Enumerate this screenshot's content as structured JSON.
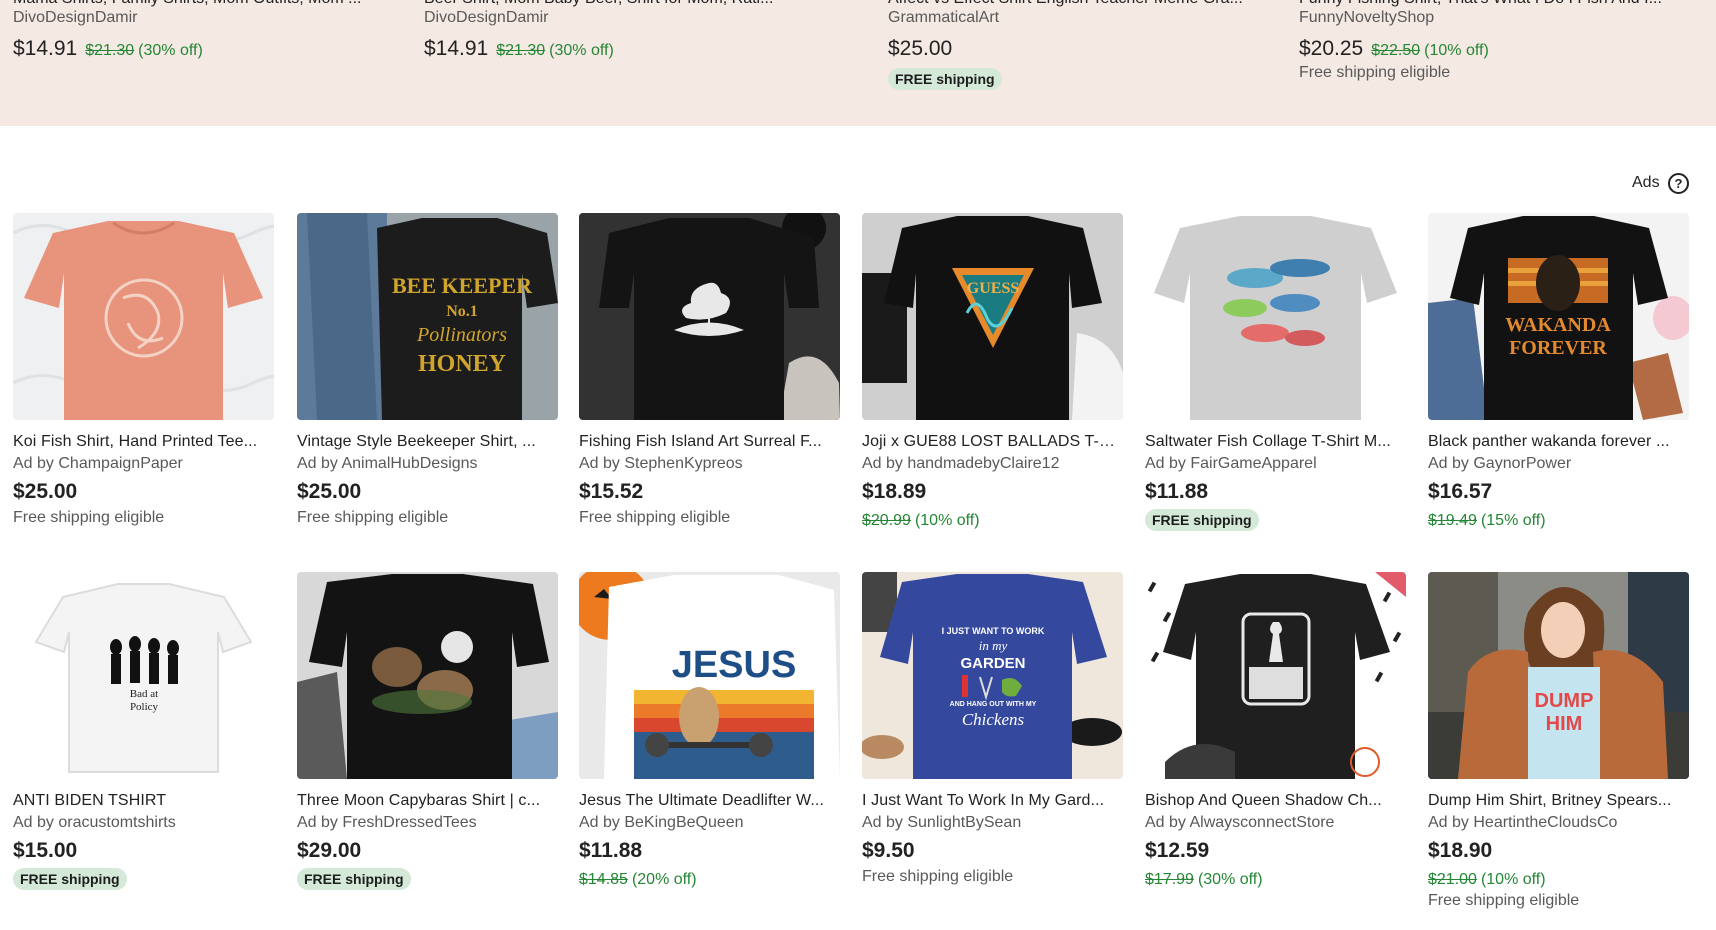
{
  "top_row": [
    {
      "title": "Mama Shirts, Family Shirts, Mom Outfits, Mom ...",
      "shop": "DivoDesignDamir",
      "price": "$14.91",
      "original": "$21.30",
      "discount": "(30% off)",
      "shipping": ""
    },
    {
      "title": "Beer Shirt, Mom Baby Beer, Shirt for Mom, Rati...",
      "shop": "DivoDesignDamir",
      "price": "$14.91",
      "original": "$21.30",
      "discount": "(30% off)",
      "shipping": ""
    },
    {
      "title": "Affect vs Effect Shirt English Teacher Meme Gra...",
      "shop": "GrammaticalArt",
      "price": "$25.00",
      "original": "",
      "discount": "",
      "shipping": "FREE shipping"
    },
    {
      "title": "Funny Fishing Shirt, That's What I Do I Fish And I...",
      "shop": "FunnyNoveltyShop",
      "price": "$20.25",
      "original": "$22.50",
      "discount": "(10% off)",
      "shipping": "Free shipping eligible"
    }
  ],
  "ads_label": "Ads",
  "ads_help": "?",
  "row1": [
    {
      "title": "Koi Fish Shirt, Hand Printed Tee...",
      "shop": "Ad by ChampaignPaper",
      "price": "$25.00",
      "original": "",
      "discount": "",
      "eligible": "Free shipping eligible",
      "badge": ""
    },
    {
      "title": "Vintage Style Beekeeper Shirt, ...",
      "shop": "Ad by AnimalHubDesigns",
      "price": "$25.00",
      "original": "",
      "discount": "",
      "eligible": "Free shipping eligible",
      "badge": ""
    },
    {
      "title": "Fishing Fish Island Art Surreal F...",
      "shop": "Ad by StephenKypreos",
      "price": "$15.52",
      "original": "",
      "discount": "",
      "eligible": "Free shipping eligible",
      "badge": ""
    },
    {
      "title": "Joji x GUE88 LOST BALLADS T-S...",
      "shop": "Ad by handmadebyClaire12",
      "price": "$18.89",
      "original": "$20.99",
      "discount": "(10% off)",
      "eligible": "",
      "badge": ""
    },
    {
      "title": "Saltwater Fish Collage T-Shirt M...",
      "shop": "Ad by FairGameApparel",
      "price": "$11.88",
      "original": "",
      "discount": "",
      "eligible": "",
      "badge": "FREE shipping"
    },
    {
      "title": "Black panther wakanda forever ...",
      "shop": "Ad by GaynorPower",
      "price": "$16.57",
      "original": "$19.49",
      "discount": "(15% off)",
      "eligible": "",
      "badge": ""
    }
  ],
  "row2": [
    {
      "title": "ANTI BIDEN TSHIRT",
      "shop": "Ad by oracustomtshirts",
      "price": "$15.00",
      "original": "",
      "discount": "",
      "eligible": "",
      "badge": "FREE shipping"
    },
    {
      "title": "Three Moon Capybaras Shirt | c...",
      "shop": "Ad by FreshDressedTees",
      "price": "$29.00",
      "original": "",
      "discount": "",
      "eligible": "",
      "badge": "FREE shipping"
    },
    {
      "title": "Jesus The Ultimate Deadlifter W...",
      "shop": "Ad by BeKingBeQueen",
      "price": "$11.88",
      "original": "$14.85",
      "discount": "(20% off)",
      "eligible": "",
      "badge": ""
    },
    {
      "title": "I Just Want To Work In My Gard...",
      "shop": "Ad by SunlightBySean",
      "price": "$9.50",
      "original": "",
      "discount": "",
      "eligible": "Free shipping eligible",
      "badge": ""
    },
    {
      "title": "Bishop And Queen Shadow Ch...",
      "shop": "Ad by AlwaysconnectStore",
      "price": "$12.59",
      "original": "$17.99",
      "discount": "(30% off)",
      "eligible": "",
      "badge": ""
    },
    {
      "title": "Dump Him Shirt, Britney Spears...",
      "shop": "Ad by HeartintheCloudsCo",
      "price": "$18.90",
      "original": "$21.00",
      "discount": "(10% off)",
      "eligible": "Free shipping eligible",
      "badge": ""
    }
  ],
  "shirt_prints": {
    "bee": [
      "BEE KEEPER",
      "No.1",
      "Pollinators",
      "HONEY"
    ],
    "guess": "GUESS",
    "wakanda": [
      "WAKANDA",
      "FOREVER"
    ],
    "biden": [
      "Bad at",
      "Policy"
    ],
    "jesus": "JESUS",
    "garden": [
      "I JUST WANT TO WORK",
      "in my",
      "GARDEN",
      "AND HANG OUT WITH MY",
      "Chickens"
    ],
    "dump": [
      "DUMP",
      "HIM"
    ]
  },
  "colors": {
    "discount_green": "#258635",
    "badge_bg": "#d4e9d7",
    "top_band": "#f5e9e4"
  }
}
